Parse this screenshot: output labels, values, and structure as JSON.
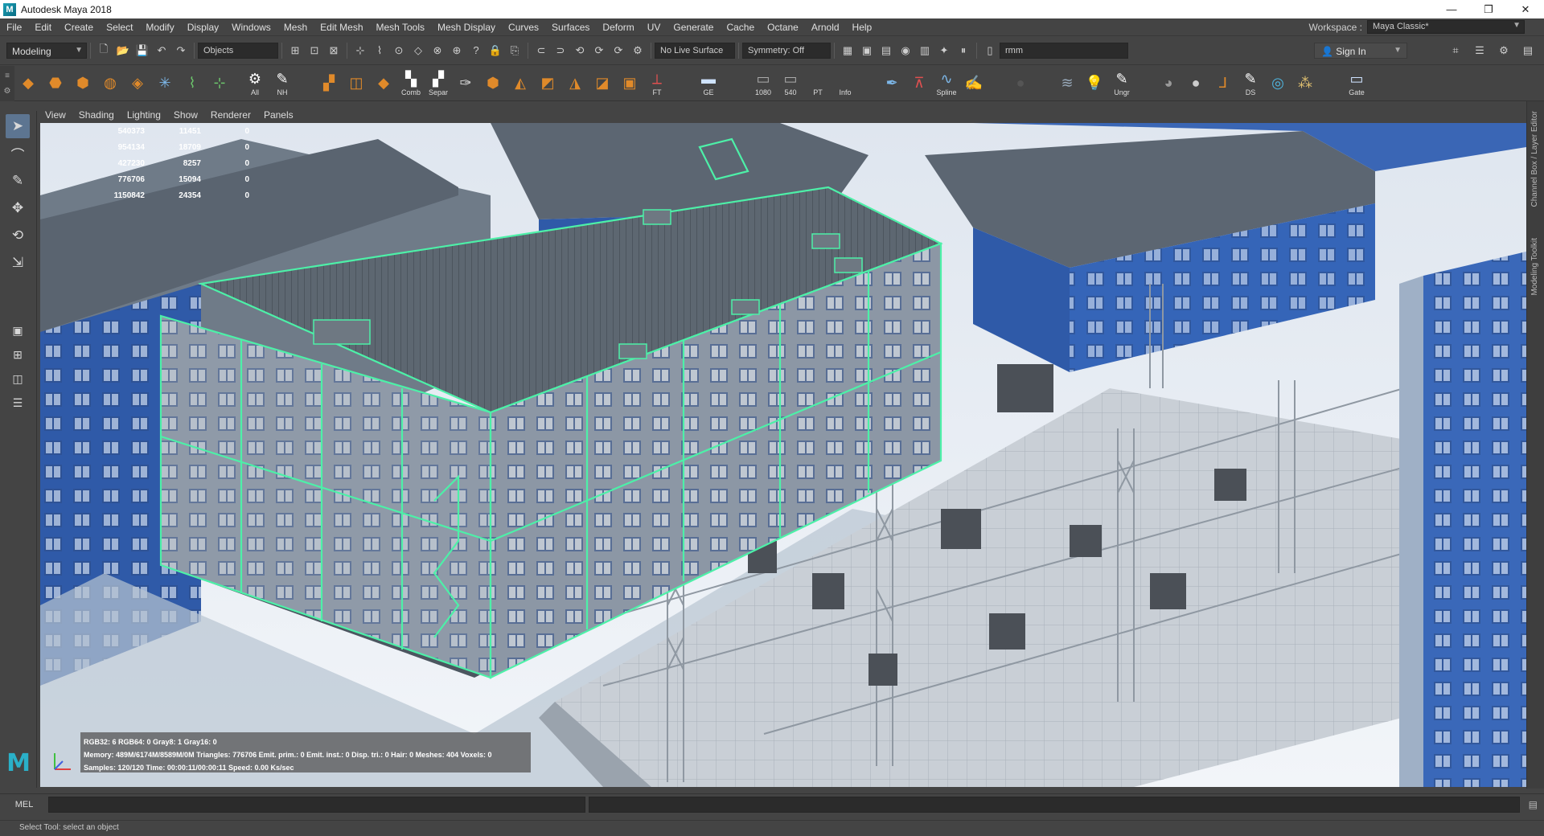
{
  "window": {
    "title": "Autodesk Maya 2018",
    "logo_letter": "M",
    "minimize": "—",
    "maximize": "❐",
    "close": "✕"
  },
  "menu": [
    "File",
    "Edit",
    "Create",
    "Select",
    "Modify",
    "Display",
    "Windows",
    "Mesh",
    "Edit Mesh",
    "Mesh Tools",
    "Mesh Display",
    "Curves",
    "Surfaces",
    "Deform",
    "UV",
    "Generate",
    "Cache",
    "Octane",
    "Arnold",
    "Help"
  ],
  "workspace": {
    "label": "Workspace :",
    "value": "Maya Classic*"
  },
  "statusline": {
    "menuset": "Modeling",
    "selection_mask": "Objects",
    "live_surface": "No Live Surface",
    "symmetry": "Symmetry: Off",
    "search": "rmm",
    "signin": "Sign In"
  },
  "shelf": {
    "labels": [
      "All",
      "NH",
      "Comb",
      "Separ",
      "FT",
      "GE",
      "1080",
      "540",
      "PT",
      "Info",
      "Spline",
      "Ungr",
      "DS",
      "Gate"
    ]
  },
  "panel_menu": [
    "View",
    "Shading",
    "Lighting",
    "Show",
    "Renderer",
    "Panels"
  ],
  "hud": {
    "rows": [
      [
        "540373",
        "11451",
        "0"
      ],
      [
        "954134",
        "18709",
        "0"
      ],
      [
        "427230",
        "8257",
        "0"
      ],
      [
        "776706",
        "15094",
        "0"
      ],
      [
        "1150842",
        "24354",
        "0"
      ]
    ]
  },
  "render_info": {
    "line1": "RGB32: 6 RGB64: 0 Gray8: 1 Gray16: 0",
    "line2": "Memory: 489M/6174M/8589M/0M Triangles: 776706 Emit. prim.: 0 Emit. inst.: 0 Disp. tri.: 0 Hair: 0 Meshes: 404 Voxels: 0",
    "line3": "Samples: 120/120 Time: 00:00:11/00:00:11 Speed: 0.00 Ks/sec"
  },
  "right_strip": {
    "top": "Channel Box / Layer Editor",
    "bottom": "Modeling Toolkit"
  },
  "mel": {
    "label": "MEL"
  },
  "status_text": "Select Tool: select an object",
  "colors": {
    "selection_wire": "#4df0a8",
    "maya_accent": "#2ab0c8",
    "active_tool": "#5d7591"
  }
}
